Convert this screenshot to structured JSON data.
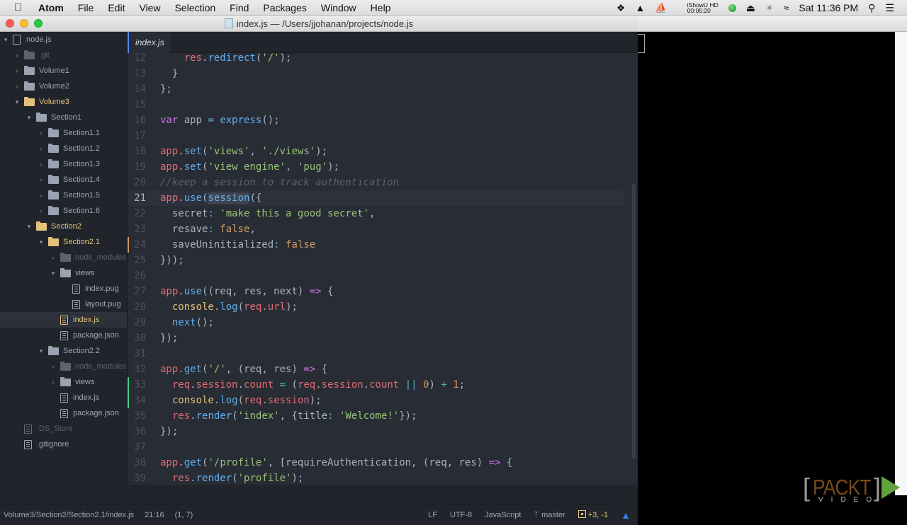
{
  "menubar": {
    "app_name": "Atom",
    "items": [
      "File",
      "Edit",
      "View",
      "Selection",
      "Find",
      "Packages",
      "Window",
      "Help"
    ],
    "tray": {
      "ishowu_label": "iShowU HD",
      "ishowu_time": "00:05:20",
      "clock": "Sat 11:36 PM"
    }
  },
  "window": {
    "title": "index.js — /Users/jjohanan/projects/node.js"
  },
  "tree": {
    "root": "node.js",
    "items": [
      {
        "label": ".git",
        "type": "folder",
        "state": "collapsed",
        "depth": 1,
        "style": "dim"
      },
      {
        "label": "Volume1",
        "type": "folder",
        "state": "collapsed",
        "depth": 1,
        "style": ""
      },
      {
        "label": "Volume2",
        "type": "folder",
        "state": "collapsed",
        "depth": 1,
        "style": ""
      },
      {
        "label": "Volume3",
        "type": "folder",
        "state": "expanded",
        "depth": 1,
        "style": "mod"
      },
      {
        "label": "Section1",
        "type": "folder",
        "state": "expanded",
        "depth": 2,
        "style": ""
      },
      {
        "label": "Section1.1",
        "type": "folder",
        "state": "collapsed",
        "depth": 3,
        "style": ""
      },
      {
        "label": "Section1.2",
        "type": "folder",
        "state": "collapsed",
        "depth": 3,
        "style": ""
      },
      {
        "label": "Section1.3",
        "type": "folder",
        "state": "collapsed",
        "depth": 3,
        "style": ""
      },
      {
        "label": "Section1.4",
        "type": "folder",
        "state": "collapsed",
        "depth": 3,
        "style": ""
      },
      {
        "label": "Section1.5",
        "type": "folder",
        "state": "collapsed",
        "depth": 3,
        "style": ""
      },
      {
        "label": "Section1.6",
        "type": "folder",
        "state": "collapsed",
        "depth": 3,
        "style": ""
      },
      {
        "label": "Section2",
        "type": "folder",
        "state": "expanded",
        "depth": 2,
        "style": "mod"
      },
      {
        "label": "Section2.1",
        "type": "folder",
        "state": "expanded",
        "depth": 3,
        "style": "mod"
      },
      {
        "label": "node_modules",
        "type": "folder",
        "state": "collapsed",
        "depth": 4,
        "style": "dim"
      },
      {
        "label": "views",
        "type": "folder",
        "state": "expanded",
        "depth": 4,
        "style": ""
      },
      {
        "label": "index.pug",
        "type": "file",
        "state": "",
        "depth": 5,
        "style": ""
      },
      {
        "label": "layout.pug",
        "type": "file",
        "state": "",
        "depth": 5,
        "style": ""
      },
      {
        "label": "index.js",
        "type": "file",
        "state": "",
        "depth": 4,
        "style": "selected"
      },
      {
        "label": "package.json",
        "type": "file",
        "state": "",
        "depth": 4,
        "style": ""
      },
      {
        "label": "Section2.2",
        "type": "folder",
        "state": "expanded",
        "depth": 3,
        "style": ""
      },
      {
        "label": "node_modules",
        "type": "folder",
        "state": "collapsed",
        "depth": 4,
        "style": "dim"
      },
      {
        "label": "views",
        "type": "folder",
        "state": "collapsed",
        "depth": 4,
        "style": ""
      },
      {
        "label": "index.js",
        "type": "file",
        "state": "",
        "depth": 4,
        "style": ""
      },
      {
        "label": "package.json",
        "type": "file",
        "state": "",
        "depth": 4,
        "style": ""
      },
      {
        "label": ".DS_Store",
        "type": "file",
        "state": "",
        "depth": 1,
        "style": "dim"
      },
      {
        "label": ".gitignore",
        "type": "file",
        "state": "",
        "depth": 1,
        "style": ""
      }
    ]
  },
  "tab": {
    "label": "index.js"
  },
  "editor": {
    "current_line": 21,
    "lines": [
      {
        "n": 12,
        "tokens": [
          [
            "",
            "    "
          ],
          [
            "v",
            "res"
          ],
          [
            "",
            "."
          ],
          [
            "f",
            "redirect"
          ],
          [
            "",
            "("
          ],
          [
            "s",
            "'/'"
          ],
          [
            "",
            ");"
          ]
        ]
      },
      {
        "n": 13,
        "tokens": [
          [
            "",
            "  }"
          ]
        ]
      },
      {
        "n": 14,
        "tokens": [
          [
            "",
            "};"
          ]
        ]
      },
      {
        "n": 15,
        "tokens": []
      },
      {
        "n": 16,
        "tokens": [
          [
            "k",
            "var"
          ],
          [
            "",
            " app "
          ],
          [
            "o",
            "="
          ],
          [
            "",
            " "
          ],
          [
            "f",
            "express"
          ],
          [
            "",
            "();"
          ]
        ]
      },
      {
        "n": 17,
        "tokens": []
      },
      {
        "n": 18,
        "tokens": [
          [
            "v",
            "app"
          ],
          [
            "",
            "."
          ],
          [
            "f",
            "set"
          ],
          [
            "",
            "("
          ],
          [
            "s",
            "'views'"
          ],
          [
            "",
            ", "
          ],
          [
            "s",
            "'./views'"
          ],
          [
            "",
            ");"
          ]
        ]
      },
      {
        "n": 19,
        "tokens": [
          [
            "v",
            "app"
          ],
          [
            "",
            "."
          ],
          [
            "f",
            "set"
          ],
          [
            "",
            "("
          ],
          [
            "s",
            "'view engine'"
          ],
          [
            "",
            ", "
          ],
          [
            "s",
            "'pug'"
          ],
          [
            "",
            ");"
          ]
        ]
      },
      {
        "n": 20,
        "tokens": [
          [
            "c",
            "//keep a session to track authentication"
          ]
        ]
      },
      {
        "n": 21,
        "tokens": [
          [
            "v",
            "app"
          ],
          [
            "",
            "."
          ],
          [
            "f",
            "use"
          ],
          [
            "",
            "("
          ],
          [
            "fsel",
            "session"
          ],
          [
            "",
            "({"
          ]
        ]
      },
      {
        "n": 22,
        "tokens": [
          [
            "",
            "  secret"
          ],
          [
            "o",
            ":"
          ],
          [
            "",
            " "
          ],
          [
            "s",
            "'make this a good secret'"
          ],
          [
            "",
            ","
          ]
        ]
      },
      {
        "n": 23,
        "tokens": [
          [
            "",
            "  resave"
          ],
          [
            "o",
            ":"
          ],
          [
            "",
            " "
          ],
          [
            "n",
            "false"
          ],
          [
            "",
            ","
          ]
        ]
      },
      {
        "n": 24,
        "tokens": [
          [
            "",
            "  saveUninitialized"
          ],
          [
            "o",
            ":"
          ],
          [
            "",
            " "
          ],
          [
            "n",
            "false"
          ]
        ]
      },
      {
        "n": 25,
        "tokens": [
          [
            "",
            "}));"
          ]
        ]
      },
      {
        "n": 26,
        "tokens": []
      },
      {
        "n": 27,
        "tokens": [
          [
            "v",
            "app"
          ],
          [
            "",
            "."
          ],
          [
            "f",
            "use"
          ],
          [
            "",
            "((req, res, next) "
          ],
          [
            "k",
            "=>"
          ],
          [
            "",
            " {"
          ]
        ]
      },
      {
        "n": 28,
        "tokens": [
          [
            "",
            "  "
          ],
          [
            "y",
            "console"
          ],
          [
            "",
            "."
          ],
          [
            "f",
            "log"
          ],
          [
            "",
            "("
          ],
          [
            "v",
            "req"
          ],
          [
            "",
            "."
          ],
          [
            "v",
            "url"
          ],
          [
            "",
            ");"
          ]
        ]
      },
      {
        "n": 29,
        "tokens": [
          [
            "",
            "  "
          ],
          [
            "f",
            "next"
          ],
          [
            "",
            "();"
          ]
        ]
      },
      {
        "n": 30,
        "tokens": [
          [
            "",
            "});"
          ]
        ]
      },
      {
        "n": 31,
        "tokens": []
      },
      {
        "n": 32,
        "tokens": [
          [
            "v",
            "app"
          ],
          [
            "",
            "."
          ],
          [
            "f",
            "get"
          ],
          [
            "",
            "("
          ],
          [
            "s",
            "'/'"
          ],
          [
            "",
            ", (req, res) "
          ],
          [
            "k",
            "=>"
          ],
          [
            "",
            " {"
          ]
        ]
      },
      {
        "n": 33,
        "tokens": [
          [
            "",
            "  "
          ],
          [
            "v",
            "req"
          ],
          [
            "",
            "."
          ],
          [
            "v",
            "session"
          ],
          [
            "",
            "."
          ],
          [
            "v",
            "count"
          ],
          [
            "",
            " "
          ],
          [
            "o",
            "="
          ],
          [
            "",
            " ("
          ],
          [
            "v",
            "req"
          ],
          [
            "",
            "."
          ],
          [
            "v",
            "session"
          ],
          [
            "",
            "."
          ],
          [
            "v",
            "count"
          ],
          [
            "",
            " "
          ],
          [
            "o",
            "||"
          ],
          [
            "",
            " "
          ],
          [
            "n",
            "0"
          ],
          [
            "",
            ") "
          ],
          [
            "o",
            "+"
          ],
          [
            "",
            " "
          ],
          [
            "n",
            "1"
          ],
          [
            "",
            ";"
          ]
        ]
      },
      {
        "n": 34,
        "tokens": [
          [
            "",
            "  "
          ],
          [
            "y",
            "console"
          ],
          [
            "",
            "."
          ],
          [
            "f",
            "log"
          ],
          [
            "",
            "("
          ],
          [
            "v",
            "req"
          ],
          [
            "",
            "."
          ],
          [
            "v",
            "session"
          ],
          [
            "",
            ");"
          ]
        ]
      },
      {
        "n": 35,
        "tokens": [
          [
            "",
            "  "
          ],
          [
            "v",
            "res"
          ],
          [
            "",
            "."
          ],
          [
            "f",
            "render"
          ],
          [
            "",
            "("
          ],
          [
            "s",
            "'index'"
          ],
          [
            "",
            ", {title"
          ],
          [
            "o",
            ":"
          ],
          [
            "",
            " "
          ],
          [
            "s",
            "'Welcome!'"
          ],
          [
            "",
            "});"
          ]
        ]
      },
      {
        "n": 36,
        "tokens": [
          [
            "",
            "});"
          ]
        ]
      },
      {
        "n": 37,
        "tokens": []
      },
      {
        "n": 38,
        "tokens": [
          [
            "v",
            "app"
          ],
          [
            "",
            "."
          ],
          [
            "f",
            "get"
          ],
          [
            "",
            "("
          ],
          [
            "s",
            "'/profile'"
          ],
          [
            "",
            ", [requireAuthentication, (req, res) "
          ],
          [
            "k",
            "=>"
          ],
          [
            "",
            " {"
          ]
        ]
      },
      {
        "n": 39,
        "tokens": [
          [
            "",
            "  "
          ],
          [
            "v",
            "res"
          ],
          [
            "",
            "."
          ],
          [
            "f",
            "render"
          ],
          [
            "",
            "("
          ],
          [
            "s",
            "'profile'"
          ],
          [
            "",
            ");"
          ]
        ]
      }
    ],
    "git_marks": {
      "24": "#d19a66",
      "33": "#43d08a",
      "34": "#43d08a"
    }
  },
  "statusbar": {
    "path": "Volume3/Section2/Section2.1/index.js",
    "cursor_pos": "21:16",
    "selection": "(1, 7)",
    "line_ending": "LF",
    "encoding": "UTF-8",
    "grammar": "JavaScript",
    "branch": "master",
    "diff": "+3, -1"
  },
  "watermark": {
    "brand": "PACKT",
    "sub": "VIDEO"
  },
  "colors": {
    "accent": "#568af2",
    "modified": "#e5c07b",
    "editor_bg": "#282c34",
    "sidebar_bg": "#21252b"
  }
}
